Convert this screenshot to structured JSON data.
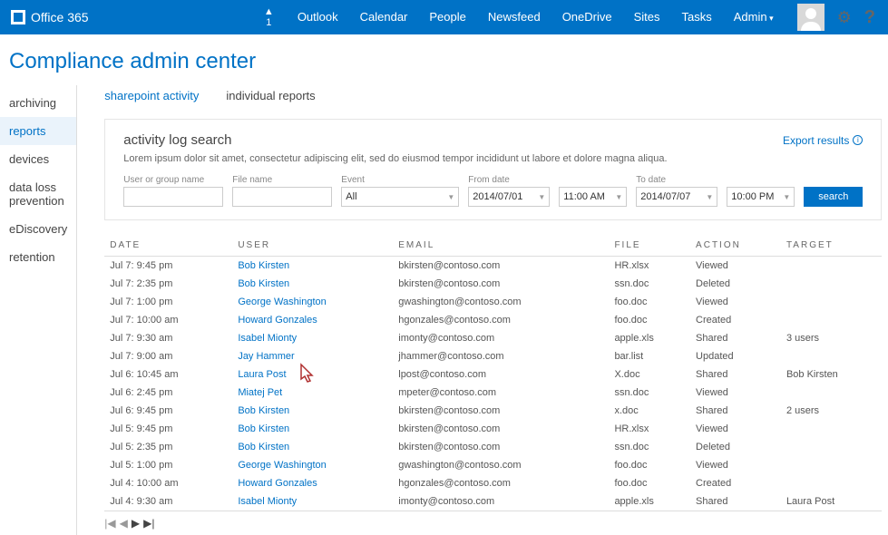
{
  "brand": "Office 365",
  "notification_count": "1",
  "nav": [
    "Outlook",
    "Calendar",
    "People",
    "Newsfeed",
    "OneDrive",
    "Sites",
    "Tasks",
    "Admin"
  ],
  "page_title": "Compliance admin center",
  "sidebar": [
    "archiving",
    "reports",
    "devices",
    "data loss prevention",
    "eDiscovery",
    "retention"
  ],
  "sidebar_active": 1,
  "tabs": [
    "sharepoint activity",
    "individual reports"
  ],
  "tab_active": 0,
  "panel": {
    "title": "activity log search",
    "export": "Export results",
    "desc": "Lorem ipsum dolor sit amet, consectetur adipiscing elit, sed do eiusmod tempor incididunt ut labore et dolore magna aliqua.",
    "filters": {
      "user_label": "User or group name",
      "file_label": "File name",
      "event_label": "Event",
      "event_value": "All",
      "from_label": "From date",
      "from_date": "2014/07/01",
      "from_time": "11:00 AM",
      "to_label": "To date",
      "to_date": "2014/07/07",
      "to_time": "10:00 PM",
      "search": "search"
    }
  },
  "columns": [
    "DATE",
    "USER",
    "EMAIL",
    "FILE",
    "ACTION",
    "TARGET"
  ],
  "rows": [
    {
      "date": "Jul 7: 9:45 pm",
      "user": "Bob Kirsten",
      "email": "bkirsten@contoso.com",
      "file": "HR.xlsx",
      "action": "Viewed",
      "target": ""
    },
    {
      "date": "Jul 7: 2:35 pm",
      "user": "Bob Kirsten",
      "email": "bkirsten@contoso.com",
      "file": "ssn.doc",
      "action": "Deleted",
      "target": ""
    },
    {
      "date": "Jul 7: 1:00 pm",
      "user": "George Washington",
      "email": "gwashington@contoso.com",
      "file": "foo.doc",
      "action": "Viewed",
      "target": ""
    },
    {
      "date": "Jul 7: 10:00 am",
      "user": "Howard Gonzales",
      "email": "hgonzales@contoso.com",
      "file": "foo.doc",
      "action": "Created",
      "target": ""
    },
    {
      "date": "Jul 7: 9:30 am",
      "user": "Isabel Mionty",
      "email": "imonty@contoso.com",
      "file": "apple.xls",
      "action": "Shared",
      "target": "3 users"
    },
    {
      "date": "Jul 7: 9:00 am",
      "user": "Jay Hammer",
      "email": "jhammer@contoso.com",
      "file": "bar.list",
      "action": "Updated",
      "target": ""
    },
    {
      "date": "Jul 6: 10:45 am",
      "user": "Laura Post",
      "email": "lpost@contoso.com",
      "file": "X.doc",
      "action": "Shared",
      "target": "Bob Kirsten"
    },
    {
      "date": "Jul 6: 2:45 pm",
      "user": "Miatej Pet",
      "email": "mpeter@contoso.com",
      "file": "ssn.doc",
      "action": "Viewed",
      "target": ""
    },
    {
      "date": "Jul 6: 9:45 pm",
      "user": "Bob Kirsten",
      "email": "bkirsten@contoso.com",
      "file": "x.doc",
      "action": "Shared",
      "target": "2 users"
    },
    {
      "date": "Jul 5: 9:45 pm",
      "user": "Bob Kirsten",
      "email": "bkirsten@contoso.com",
      "file": "HR.xlsx",
      "action": "Viewed",
      "target": ""
    },
    {
      "date": "Jul 5: 2:35 pm",
      "user": "Bob Kirsten",
      "email": "bkirsten@contoso.com",
      "file": "ssn.doc",
      "action": "Deleted",
      "target": ""
    },
    {
      "date": "Jul 5: 1:00 pm",
      "user": "George Washington",
      "email": "gwashington@contoso.com",
      "file": "foo.doc",
      "action": "Viewed",
      "target": ""
    },
    {
      "date": "Jul 4: 10:00 am",
      "user": "Howard Gonzales",
      "email": "hgonzales@contoso.com",
      "file": "foo.doc",
      "action": "Created",
      "target": ""
    },
    {
      "date": "Jul 4: 9:30 am",
      "user": "Isabel Mionty",
      "email": "imonty@contoso.com",
      "file": "apple.xls",
      "action": "Shared",
      "target": "Laura Post"
    }
  ]
}
